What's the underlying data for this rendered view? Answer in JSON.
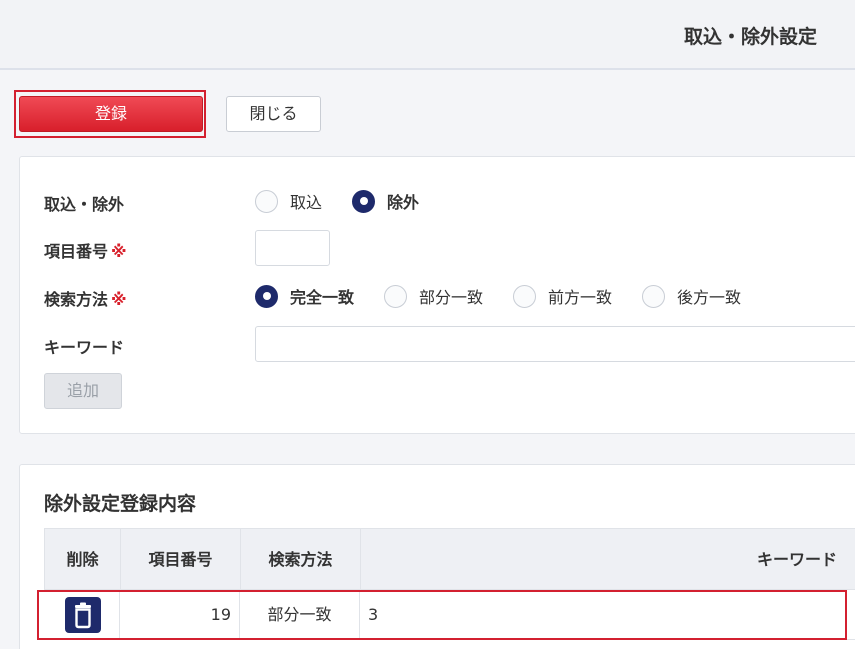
{
  "header": {
    "title": "取込・除外設定"
  },
  "toolbar": {
    "register_label": "登録",
    "close_label": "閉じる"
  },
  "form": {
    "import_exclude": {
      "label": "取込・除外",
      "options": [
        {
          "label": "取込",
          "checked": false
        },
        {
          "label": "除外",
          "checked": true
        }
      ]
    },
    "item_number": {
      "label": "項目番号",
      "required_mark": "※",
      "value": ""
    },
    "search_method": {
      "label": "検索方法",
      "required_mark": "※",
      "options": [
        {
          "label": "完全一致",
          "checked": true
        },
        {
          "label": "部分一致",
          "checked": false
        },
        {
          "label": "前方一致",
          "checked": false
        },
        {
          "label": "後方一致",
          "checked": false
        }
      ]
    },
    "keyword": {
      "label": "キーワード",
      "value": ""
    },
    "add_label": "追加"
  },
  "list": {
    "title": "除外設定登録内容",
    "columns": [
      "削除",
      "項目番号",
      "検索方法",
      "キーワード"
    ],
    "rows": [
      {
        "item_number": "19",
        "search_method": "部分一致",
        "keyword": "3"
      }
    ]
  },
  "colors": {
    "accent_red": "#d81f2b",
    "navy": "#1e2a6b"
  },
  "icons": {
    "delete": "trash-icon"
  }
}
